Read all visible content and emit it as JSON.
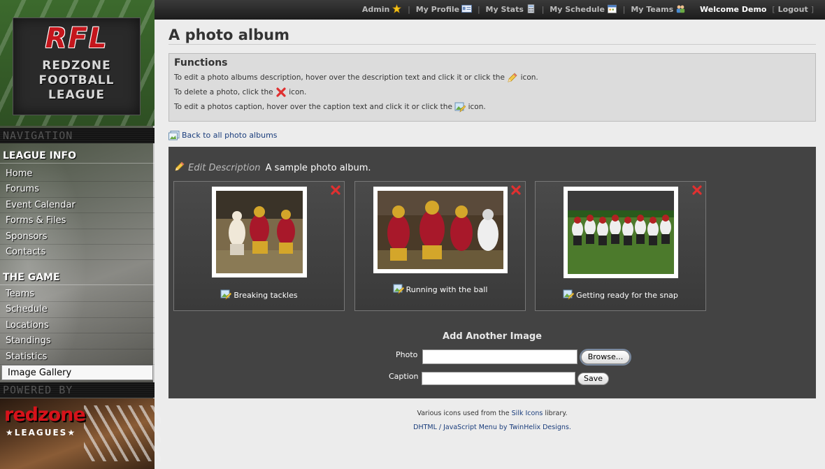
{
  "topbar": {
    "admin": "Admin",
    "my_profile": "My Profile",
    "my_stats": "My Stats",
    "my_schedule": "My Schedule",
    "my_teams": "My Teams",
    "welcome": "Welcome Demo",
    "logout": "Logout",
    "sep": "|",
    "bracket_open": "[",
    "bracket_close": "]"
  },
  "logo": {
    "abbr": "RFL",
    "lines": [
      "REDZONE",
      "FOOTBALL",
      "LEAGUE"
    ]
  },
  "sidebar": {
    "navigation_header": "NAVIGATION",
    "league_info_title": "LEAGUE INFO",
    "league_info_items": [
      "Home",
      "Forums",
      "Event Calendar",
      "Forms & Files",
      "Sponsors",
      "Contacts"
    ],
    "the_game_title": "THE GAME",
    "the_game_items": [
      "Teams",
      "Schedule",
      "Locations",
      "Standings",
      "Statistics",
      "Image Gallery"
    ],
    "active_item": "Image Gallery",
    "powered_by_header": "POWERED BY",
    "powered_brand": "redzone",
    "powered_sub": "★LEAGUES★"
  },
  "main": {
    "page_title": "A photo album",
    "functions_title": "Functions",
    "func_line1_before": "To edit a photo albums description, hover over the description text and click it or click the",
    "func_line1_after": "icon.",
    "func_line2_before": "To delete a photo, click the",
    "func_line2_after": "icon.",
    "func_line3_before": "To edit a photos caption, hover over the caption text and click it or click the",
    "func_line3_after": "icon.",
    "back_link": "Back to all photo albums",
    "edit_description": "Edit Description",
    "album_description": "A sample photo album.",
    "photos": [
      {
        "caption": "Breaking tackles"
      },
      {
        "caption": "Running with the ball"
      },
      {
        "caption": "Getting ready for the snap"
      }
    ],
    "add_image_title": "Add Another Image",
    "photo_label": "Photo",
    "caption_label": "Caption",
    "browse_button": "Browse...",
    "save_button": "Save"
  },
  "footer": {
    "line1_before": "Various icons used from the",
    "line1_link": "Silk Icons",
    "line1_after": "library.",
    "line2": "DHTML / JavaScript Menu by TwinHelix Designs."
  },
  "colors": {
    "accent_red": "#c4161c",
    "panel_dark": "#434343",
    "link_blue": "#1a3d7c"
  }
}
